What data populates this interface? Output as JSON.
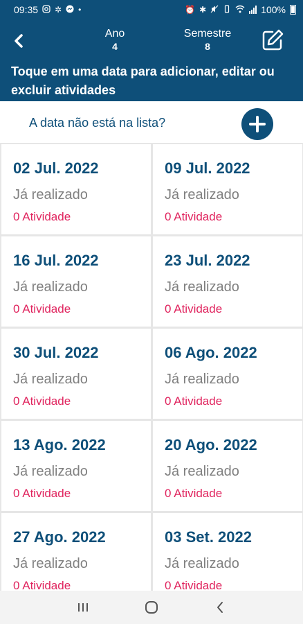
{
  "status_bar": {
    "time": "09:35",
    "battery": "100%",
    "left_icons": [
      "instagram-icon",
      "pinwheel-icon",
      "messenger-icon",
      "dot-icon"
    ],
    "right_icons": [
      "alarm-icon",
      "bluetooth-icon",
      "mute-icon",
      "vibrate-icon",
      "wifi-icon",
      "signal-icon",
      "battery-icon"
    ]
  },
  "header": {
    "ano_label": "Ano",
    "ano_value": "4",
    "semestre_label": "Semestre",
    "semestre_value": "8",
    "instruction": "Toque em uma data para adicionar, editar ou excluir atividades"
  },
  "add_row": {
    "text": "A data não está na lista?"
  },
  "dates": [
    {
      "date": "02 Jul. 2022",
      "status": "Já realizado",
      "activities": "0 Atividade"
    },
    {
      "date": "09 Jul. 2022",
      "status": "Já realizado",
      "activities": "0 Atividade"
    },
    {
      "date": "16 Jul. 2022",
      "status": "Já realizado",
      "activities": "0 Atividade"
    },
    {
      "date": "23 Jul. 2022",
      "status": "Já realizado",
      "activities": "0 Atividade"
    },
    {
      "date": "30 Jul. 2022",
      "status": "Já realizado",
      "activities": "0 Atividade"
    },
    {
      "date": "06 Ago. 2022",
      "status": "Já realizado",
      "activities": "0 Atividade"
    },
    {
      "date": "13 Ago. 2022",
      "status": "Já realizado",
      "activities": "0 Atividade"
    },
    {
      "date": "20 Ago. 2022",
      "status": "Já realizado",
      "activities": "0 Atividade"
    },
    {
      "date": "27 Ago. 2022",
      "status": "Já realizado",
      "activities": "0 Atividade"
    },
    {
      "date": "03 Set. 2022",
      "status": "Já realizado",
      "activities": "0 Atividade"
    }
  ],
  "colors": {
    "primary": "#0e4f79",
    "activity_red": "#e0245e",
    "muted_gray": "#808080",
    "grid_gap": "#e6e6e6"
  }
}
